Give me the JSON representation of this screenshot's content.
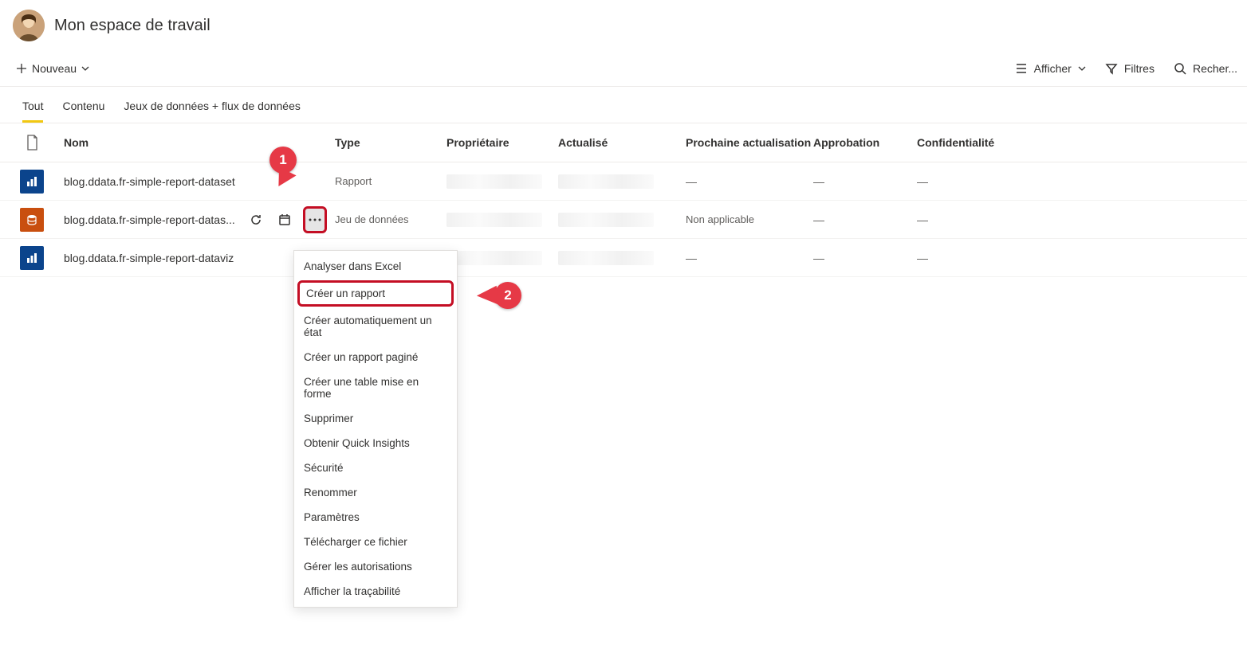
{
  "header": {
    "workspace_title": "Mon espace de travail"
  },
  "toolbar": {
    "new_label": "Nouveau",
    "view_label": "Afficher",
    "filters_label": "Filtres",
    "search_label": "Recher..."
  },
  "tabs": [
    {
      "label": "Tout",
      "active": true
    },
    {
      "label": "Contenu",
      "active": false
    },
    {
      "label": "Jeux de données + flux de données",
      "active": false
    }
  ],
  "columns": {
    "name": "Nom",
    "type": "Type",
    "owner": "Propriétaire",
    "refreshed": "Actualisé",
    "next_refresh": "Prochaine actualisation",
    "endorsement": "Approbation",
    "sensitivity": "Confidentialité"
  },
  "rows": [
    {
      "icon": "report",
      "name": "blog.ddata.fr-simple-report-dataset",
      "type": "Rapport",
      "next_refresh": "—",
      "endorsement": "—",
      "sensitivity": "—",
      "actions_visible": false
    },
    {
      "icon": "dataset",
      "name": "blog.ddata.fr-simple-report-datas...",
      "type": "Jeu de données",
      "next_refresh": "Non applicable",
      "endorsement": "—",
      "sensitivity": "—",
      "actions_visible": true
    },
    {
      "icon": "report",
      "name": "blog.ddata.fr-simple-report-dataviz",
      "type": "",
      "next_refresh": "—",
      "endorsement": "—",
      "sensitivity": "—",
      "actions_visible": false
    }
  ],
  "context_menu": [
    "Analyser dans Excel",
    "Créer un rapport",
    "Créer automatiquement un état",
    "Créer un rapport paginé",
    "Créer une table mise en forme",
    "Supprimer",
    "Obtenir Quick Insights",
    "Sécurité",
    "Renommer",
    "Paramètres",
    "Télécharger ce fichier",
    "Gérer les autorisations",
    "Afficher la traçabilité"
  ],
  "annotations": {
    "callout1": "1",
    "callout2": "2"
  }
}
